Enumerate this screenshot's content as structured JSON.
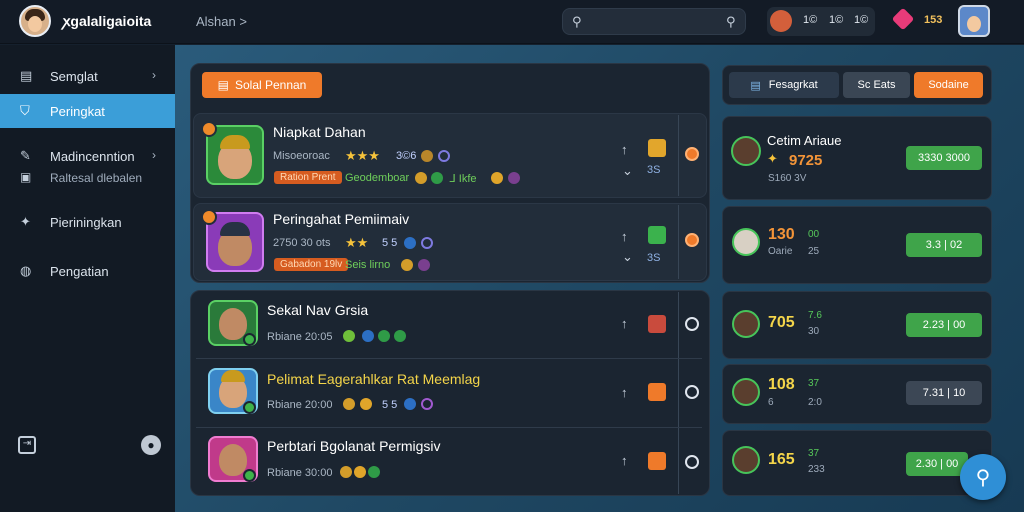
{
  "topbar": {
    "logo": "ꭗgalaligaioita",
    "crumb": "Alshan ˃",
    "search_placeholder": "",
    "stats": {
      "a": "1©",
      "b": "1©",
      "c": "1©"
    },
    "gem_value": "153"
  },
  "sidebar": {
    "items": [
      {
        "label": "Semglat",
        "icon": "menu-icon",
        "chevron": "›"
      },
      {
        "label": "Peringkat",
        "icon": "trophy-icon",
        "chevron": ""
      },
      {
        "label": "Madincenntion",
        "icon": "edit-icon",
        "chevron": "›"
      },
      {
        "label": "Pieriningkan",
        "icon": "star-icon",
        "chevron": ""
      },
      {
        "label": "Pengatian",
        "icon": "globe-icon",
        "chevron": ""
      }
    ],
    "sub_label": "Raltesal dlebalen"
  },
  "main": {
    "header_button": "Solal Pennan",
    "rows": [
      {
        "name": "Niapkat Dahan",
        "sub1": "Misoeoroac",
        "stars": "★★★",
        "num": "3©6",
        "tag": "Ration Prent",
        "sub2": "Geodemboar",
        "sub2b": "ᒧ Ikfe"
      },
      {
        "name": "Peringahat Pemiimaiv",
        "sub1": "2750 30 ots",
        "stars": "★★",
        "num": "5 5",
        "tag": "Gabadon 19lv",
        "sub2": "Seis lirno"
      },
      {
        "name": "Sekal Nav Grsia",
        "sub1": "Rbiane 20:05"
      },
      {
        "name": "Pelimat Eagerahlkar Rat Meemlag",
        "sub1": "Rbiane 20:00",
        "num": "5 5"
      },
      {
        "name": "Perbtari Bgolanat Permigsiv",
        "sub1": "Rbiane 30:00"
      }
    ],
    "row_side": [
      {
        "top": "3S"
      },
      {
        "top": "3S"
      }
    ]
  },
  "right": {
    "tabs": [
      "Fesagrkat",
      "Sc Eats",
      "Sodaine"
    ],
    "cards": [
      {
        "name": "Cetim Ariaue",
        "value": "9725",
        "sub": "S160 3V",
        "pill": "3330 3000"
      },
      {
        "value": "130",
        "sub_a": "00",
        "sub_b": "25",
        "pill": "3.3 | 02"
      },
      {
        "value": "705",
        "sub_a": "7.6",
        "sub_b": "30",
        "pill": "2.23 | 00"
      },
      {
        "value": "108",
        "sub_a": "37",
        "sub_b": "2:0",
        "pill": "7.31 | 10",
        "prefix": "6"
      },
      {
        "value": "165",
        "sub_a": "37",
        "sub_b": "233",
        "pill": "2.30 | 00"
      }
    ]
  },
  "colors": {
    "accent": "#3b9ed8",
    "orange": "#ef7a2a",
    "green": "#3fa44a",
    "gold": "#f4d54a"
  }
}
